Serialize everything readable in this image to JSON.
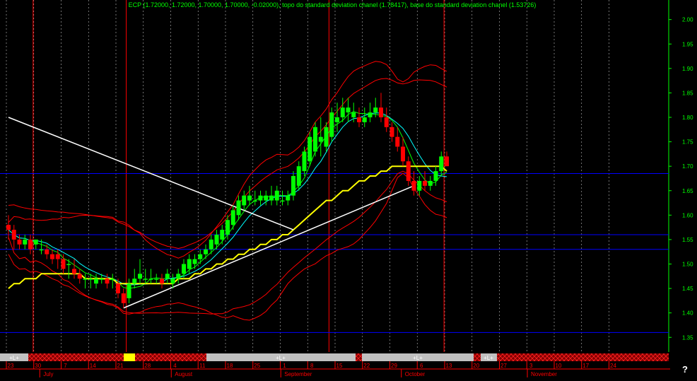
{
  "header": {
    "text": "ECP (1.72000, 1.72000, 1.70000, 1.70000, -0.02000), topo do standard deviation chanel (1.78417), base do standard deviation chanel (1.53726)"
  },
  "help_label": "?",
  "colors": {
    "background": "#000000",
    "text": "#00ff00",
    "up_candle": "#00ff00",
    "down_candle": "#ff0000",
    "envelope": "#ff0000",
    "trend_line": "#ffffff",
    "ma_long": "#ffff00",
    "ma_short": "#00ffff",
    "ma_mid": "#00ff00",
    "horizontal_levels": "#0000ff",
    "vertical_markers": "#ff0000"
  },
  "chart_data": {
    "type": "candlestick",
    "symbol": "ECP",
    "ylim": [
      1.32,
      2.04
    ],
    "y_ticks": [
      "2.00",
      "1.95",
      "1.90",
      "1.85",
      "1.80",
      "1.75",
      "1.70",
      "1.65",
      "1.60",
      "1.55",
      "1.50",
      "1.45",
      "1.40",
      "1.35"
    ],
    "x_day_ticks": [
      {
        "label": "23",
        "i": 0
      },
      {
        "label": "30",
        "i": 5
      },
      {
        "label": "7",
        "i": 10
      },
      {
        "label": "14",
        "i": 15
      },
      {
        "label": "21",
        "i": 20
      },
      {
        "label": "28",
        "i": 25
      },
      {
        "label": "4",
        "i": 30
      },
      {
        "label": "11",
        "i": 35
      },
      {
        "label": "18",
        "i": 40
      },
      {
        "label": "25",
        "i": 45
      },
      {
        "label": "1",
        "i": 50
      },
      {
        "label": "8",
        "i": 55
      },
      {
        "label": "15",
        "i": 60
      },
      {
        "label": "22",
        "i": 65
      },
      {
        "label": "29",
        "i": 70
      },
      {
        "label": "6",
        "i": 75
      },
      {
        "label": "13",
        "i": 80
      },
      {
        "label": "20",
        "i": 85
      },
      {
        "label": "27",
        "i": 90
      },
      {
        "label": "3",
        "i": 95
      },
      {
        "label": "10",
        "i": 100
      },
      {
        "label": "17",
        "i": 105
      },
      {
        "label": "24",
        "i": 110
      }
    ],
    "x_month_labels": [
      {
        "label": "July",
        "i": 7
      },
      {
        "label": "August",
        "i": 31
      },
      {
        "label": "September",
        "i": 51
      },
      {
        "label": "October",
        "i": 73
      },
      {
        "label": "November",
        "i": 96
      }
    ],
    "marker_labels": [
      "+L+",
      "+L+",
      "+L+",
      "+L+"
    ],
    "horizontal_levels": [
      1.685,
      1.56,
      1.53,
      1.36
    ],
    "red_vertical_markers": [
      4.5,
      21.5,
      58.5,
      79.5
    ],
    "trend_lines": [
      {
        "name": "",
        "from": [
          0,
          1.8
        ],
        "to": [
          52,
          1.57
        ]
      },
      {
        "name": "",
        "from": [
          21,
          1.41
        ],
        "to": [
          74,
          1.66
        ]
      }
    ],
    "series": [
      {
        "name": "ECP",
        "values": [
          [
            1.58,
            1.6,
            1.55,
            1.57
          ],
          [
            1.57,
            1.58,
            1.53,
            1.55
          ],
          [
            1.55,
            1.56,
            1.53,
            1.54
          ],
          [
            1.54,
            1.56,
            1.53,
            1.55
          ],
          [
            1.55,
            1.56,
            1.52,
            1.53
          ],
          [
            1.54,
            1.55,
            1.53,
            1.55
          ],
          [
            1.53,
            1.55,
            1.52,
            1.53
          ],
          [
            1.53,
            1.54,
            1.51,
            1.52
          ],
          [
            1.52,
            1.53,
            1.5,
            1.51
          ],
          [
            1.52,
            1.53,
            1.49,
            1.51
          ],
          [
            1.51,
            1.52,
            1.48,
            1.49
          ],
          [
            1.5,
            1.51,
            1.47,
            1.5
          ],
          [
            1.49,
            1.51,
            1.47,
            1.48
          ],
          [
            1.48,
            1.49,
            1.46,
            1.47
          ],
          [
            1.47,
            1.48,
            1.45,
            1.47
          ],
          [
            1.47,
            1.48,
            1.45,
            1.47
          ],
          [
            1.46,
            1.48,
            1.45,
            1.47
          ],
          [
            1.47,
            1.48,
            1.46,
            1.47
          ],
          [
            1.47,
            1.48,
            1.45,
            1.46
          ],
          [
            1.47,
            1.48,
            1.45,
            1.47
          ],
          [
            1.46,
            1.47,
            1.43,
            1.44
          ],
          [
            1.44,
            1.45,
            1.41,
            1.42
          ],
          [
            1.43,
            1.47,
            1.42,
            1.46
          ],
          [
            1.46,
            1.49,
            1.45,
            1.47
          ],
          [
            1.47,
            1.51,
            1.46,
            1.48
          ],
          [
            1.47,
            1.49,
            1.46,
            1.47
          ],
          [
            1.47,
            1.49,
            1.46,
            1.47
          ],
          [
            1.47,
            1.48,
            1.46,
            1.47
          ],
          [
            1.47,
            1.48,
            1.45,
            1.46
          ],
          [
            1.47,
            1.49,
            1.46,
            1.48
          ],
          [
            1.46,
            1.48,
            1.45,
            1.47
          ],
          [
            1.47,
            1.49,
            1.46,
            1.48
          ],
          [
            1.48,
            1.51,
            1.47,
            1.5
          ],
          [
            1.49,
            1.52,
            1.48,
            1.51
          ],
          [
            1.5,
            1.52,
            1.49,
            1.51
          ],
          [
            1.51,
            1.53,
            1.5,
            1.52
          ],
          [
            1.52,
            1.54,
            1.51,
            1.53
          ],
          [
            1.53,
            1.56,
            1.52,
            1.55
          ],
          [
            1.54,
            1.57,
            1.53,
            1.56
          ],
          [
            1.55,
            1.58,
            1.54,
            1.57
          ],
          [
            1.56,
            1.6,
            1.55,
            1.59
          ],
          [
            1.58,
            1.62,
            1.57,
            1.61
          ],
          [
            1.6,
            1.64,
            1.59,
            1.63
          ],
          [
            1.62,
            1.65,
            1.61,
            1.64
          ],
          [
            1.63,
            1.66,
            1.62,
            1.64
          ],
          [
            1.63,
            1.65,
            1.62,
            1.63
          ],
          [
            1.63,
            1.65,
            1.62,
            1.64
          ],
          [
            1.63,
            1.65,
            1.62,
            1.64
          ],
          [
            1.63,
            1.66,
            1.62,
            1.64
          ],
          [
            1.63,
            1.66,
            1.62,
            1.65
          ],
          [
            1.63,
            1.65,
            1.62,
            1.63
          ],
          [
            1.63,
            1.65,
            1.62,
            1.64
          ],
          [
            1.64,
            1.69,
            1.63,
            1.68
          ],
          [
            1.66,
            1.71,
            1.65,
            1.7
          ],
          [
            1.69,
            1.74,
            1.68,
            1.73
          ],
          [
            1.71,
            1.77,
            1.7,
            1.76
          ],
          [
            1.73,
            1.79,
            1.72,
            1.78
          ],
          [
            1.75,
            1.8,
            1.72,
            1.76
          ],
          [
            1.74,
            1.79,
            1.73,
            1.78
          ],
          [
            1.76,
            1.82,
            1.75,
            1.81
          ],
          [
            1.79,
            1.83,
            1.77,
            1.8
          ],
          [
            1.8,
            1.84,
            1.79,
            1.82
          ],
          [
            1.81,
            1.84,
            1.79,
            1.82
          ],
          [
            1.8,
            1.83,
            1.79,
            1.81
          ],
          [
            1.8,
            1.82,
            1.78,
            1.79
          ],
          [
            1.79,
            1.82,
            1.78,
            1.8
          ],
          [
            1.8,
            1.83,
            1.79,
            1.81
          ],
          [
            1.81,
            1.84,
            1.8,
            1.82
          ],
          [
            1.82,
            1.85,
            1.79,
            1.8
          ],
          [
            1.8,
            1.82,
            1.77,
            1.78
          ],
          [
            1.78,
            1.79,
            1.75,
            1.76
          ],
          [
            1.76,
            1.78,
            1.73,
            1.74
          ],
          [
            1.74,
            1.76,
            1.7,
            1.71
          ],
          [
            1.71,
            1.72,
            1.66,
            1.67
          ],
          [
            1.67,
            1.69,
            1.64,
            1.65
          ],
          [
            1.65,
            1.68,
            1.64,
            1.67
          ],
          [
            1.67,
            1.69,
            1.65,
            1.66
          ],
          [
            1.66,
            1.68,
            1.65,
            1.67
          ],
          [
            1.67,
            1.7,
            1.66,
            1.69
          ],
          [
            1.69,
            1.73,
            1.68,
            1.72
          ],
          [
            1.72,
            1.73,
            1.7,
            1.7
          ]
        ]
      },
      {
        "name": "",
        "values": [
          1.45,
          1.46,
          1.46,
          1.47,
          1.47,
          1.47,
          1.48,
          1.48,
          1.48,
          1.48,
          1.48,
          1.48,
          1.48,
          1.48,
          1.47,
          1.47,
          1.47,
          1.47,
          1.47,
          1.47,
          1.46,
          1.46,
          1.46,
          1.46,
          1.46,
          1.46,
          1.46,
          1.46,
          1.46,
          1.46,
          1.46,
          1.47,
          1.47,
          1.47,
          1.48,
          1.48,
          1.49,
          1.49,
          1.5,
          1.5,
          1.51,
          1.51,
          1.52,
          1.52,
          1.53,
          1.53,
          1.54,
          1.54,
          1.55,
          1.55,
          1.56,
          1.56,
          1.57,
          1.58,
          1.59,
          1.6,
          1.61,
          1.62,
          1.63,
          1.63,
          1.64,
          1.65,
          1.65,
          1.66,
          1.67,
          1.67,
          1.68,
          1.68,
          1.69,
          1.69,
          1.7,
          1.7,
          1.7,
          1.7,
          1.7,
          1.7,
          1.7,
          1.7,
          1.7,
          1.7,
          1.69
        ]
      }
    ]
  }
}
